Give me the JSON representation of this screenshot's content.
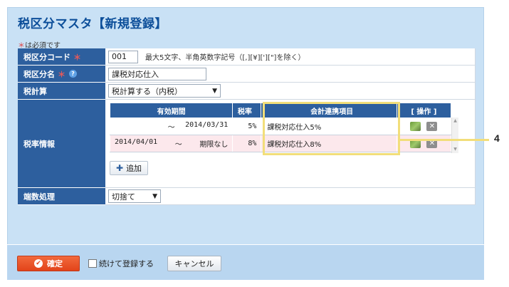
{
  "page": {
    "title": "税区分マスタ【新規登録】",
    "required_mark": "＊",
    "required_note": "は必須です"
  },
  "form": {
    "code": {
      "label": "税区分コード",
      "value": "001",
      "hint": "最大5文字、半角英数字記号（[,][¥]['][\"]を除く）"
    },
    "name": {
      "label": "税区分名",
      "value": "課税対応仕入"
    },
    "tax_calc": {
      "label": "税計算",
      "selected": "税計算する（内税）"
    },
    "tax_rate": {
      "label": "税率情報",
      "headers": {
        "period": "有効期間",
        "rate": "税率",
        "link": "会計連携項目",
        "ops": "[ 操作 ]"
      },
      "rows": [
        {
          "start": "",
          "sep": "～",
          "end": "2014/03/31",
          "rate": "5%",
          "link": "課税対応仕入5%"
        },
        {
          "start": "2014/04/01",
          "sep": "～",
          "end": "期限なし",
          "rate": "8%",
          "link": "課税対応仕入8%"
        }
      ],
      "add_label": "追加"
    },
    "rounding": {
      "label": "端数処理",
      "selected": "切捨て"
    }
  },
  "callout": {
    "number": "4",
    "color": "#f2de7a"
  },
  "footer": {
    "confirm_label": "確定",
    "continue_label": "続けて登録する",
    "cancel_label": "キャンセル"
  },
  "colors": {
    "header_blue": "#2d5f9e",
    "panel_bg": "#c9e1f5",
    "confirm_orange": "#e2431a",
    "row_pink": "#fce8ec"
  }
}
